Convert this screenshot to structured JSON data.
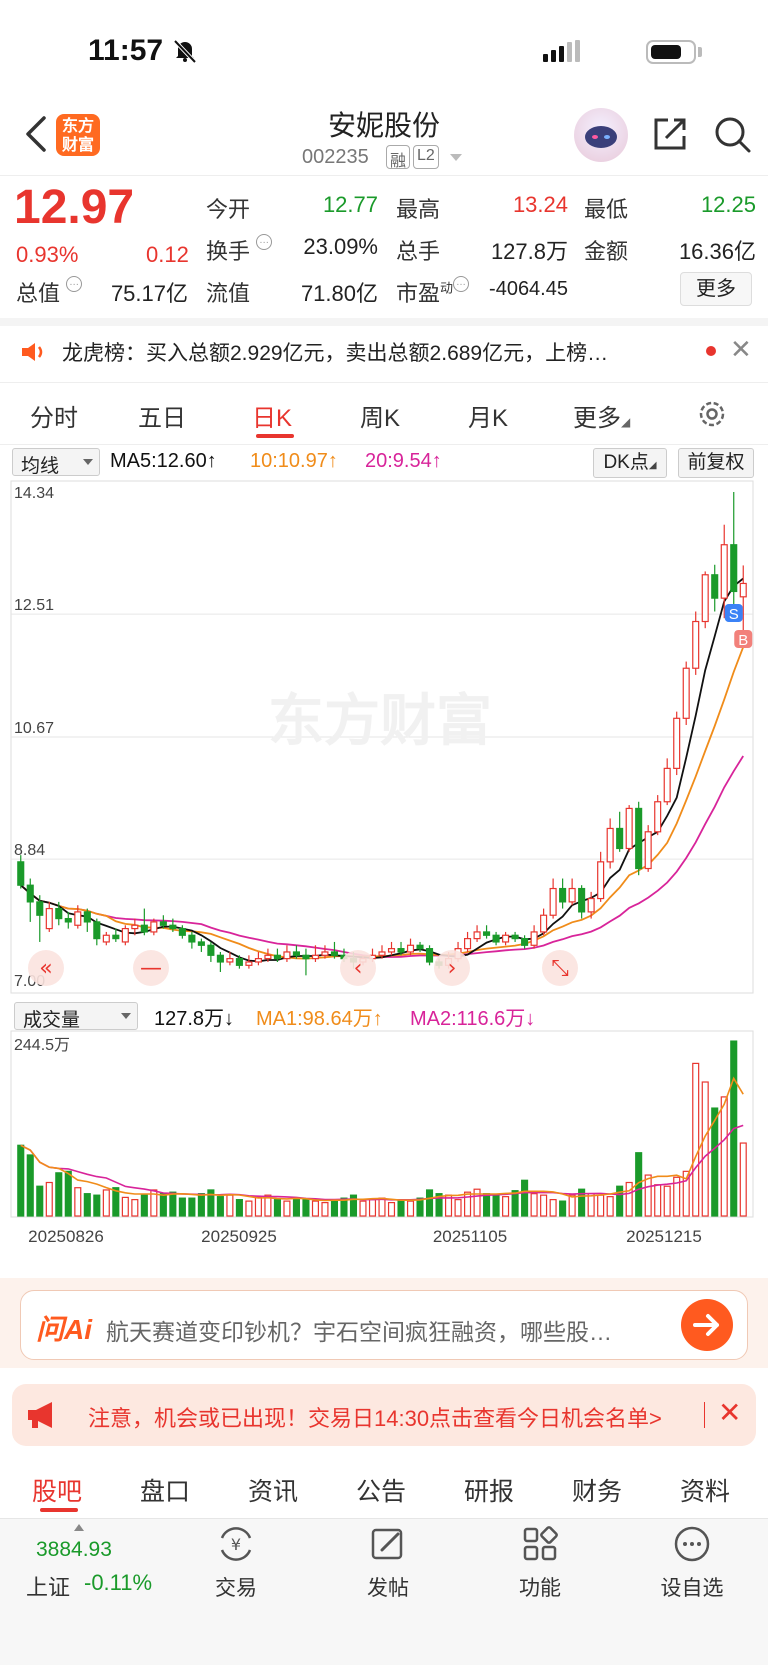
{
  "status": {
    "time": "11:57"
  },
  "header": {
    "name": "安妮股份",
    "code": "002235",
    "badge1": "融",
    "badge2": "L2",
    "logo_line1": "东方",
    "logo_line2": "财富"
  },
  "quote": {
    "price": "12.97",
    "pct": "0.93%",
    "change": "0.12",
    "open_label": "今开",
    "open": "12.77",
    "high_label": "最高",
    "high": "13.24",
    "low_label": "最低",
    "low": "12.25",
    "turnover_label": "换手",
    "turnover": "23.09%",
    "volume_label": "总手",
    "volume": "127.8万",
    "amount_label": "金额",
    "amount": "16.36亿",
    "mcap_label": "总值",
    "mcap": "75.17亿",
    "float_label": "流值",
    "float": "71.80亿",
    "pe_label": "市盈",
    "pe_sup": "动",
    "pe": "-4064.45",
    "more": "更多"
  },
  "notice": {
    "text": "龙虎榜：买入总额2.929亿元，卖出总额2.689亿元，上榜…"
  },
  "tabs": [
    "分时",
    "五日",
    "日K",
    "周K",
    "月K",
    "更多"
  ],
  "active_tab": 2,
  "chart_toolbar": {
    "indicator": "均线",
    "ma5": "MA5:12.60↑",
    "ma10": "10:10.97↑",
    "ma20": "20:9.54↑",
    "dk": "DK点",
    "adjust": "前复权",
    "ma5_color": "#111111",
    "ma10_color": "#f08c1a",
    "ma20_color": "#d8249a"
  },
  "volume_toolbar": {
    "indicator": "成交量",
    "vol": "127.8万↓",
    "ma1": "MA1:98.64万↑",
    "ma2": "MA2:116.6万↓"
  },
  "chart_data": {
    "type": "candlestick",
    "y_ticks": [
      "14.34",
      "12.51",
      "10.67",
      "8.84",
      "7.00"
    ],
    "ylim": [
      7.0,
      14.34
    ],
    "vol_max_label": "244.5万",
    "x_ticks": [
      "20250826",
      "20250925",
      "20251105",
      "20251215"
    ],
    "watermark": "东方财富",
    "up_color": "#e8352e",
    "down_color": "#1a9a2a",
    "candles": [
      [
        8.8,
        8.45,
        8.9,
        8.4
      ],
      [
        8.45,
        8.2,
        8.55,
        7.9
      ],
      [
        8.2,
        8.0,
        8.3,
        7.6
      ],
      [
        7.8,
        8.1,
        8.2,
        7.75
      ],
      [
        8.1,
        7.95,
        8.2,
        7.85
      ],
      [
        7.95,
        7.9,
        8.05,
        7.8
      ],
      [
        7.85,
        8.05,
        8.15,
        7.8
      ],
      [
        8.05,
        7.9,
        8.1,
        7.75
      ],
      [
        7.9,
        7.65,
        7.95,
        7.55
      ],
      [
        7.6,
        7.7,
        7.75,
        7.55
      ],
      [
        7.7,
        7.65,
        7.8,
        7.6
      ],
      [
        7.6,
        7.8,
        7.85,
        7.55
      ],
      [
        7.8,
        7.85,
        7.95,
        7.7
      ],
      [
        7.85,
        7.75,
        8.1,
        7.7
      ],
      [
        7.75,
        7.9,
        7.95,
        7.7
      ],
      [
        7.9,
        7.85,
        8.0,
        7.8
      ],
      [
        7.85,
        7.8,
        7.95,
        7.75
      ],
      [
        7.8,
        7.7,
        7.85,
        7.65
      ],
      [
        7.7,
        7.6,
        7.75,
        7.5
      ],
      [
        7.6,
        7.55,
        7.65,
        7.45
      ],
      [
        7.55,
        7.4,
        7.6,
        7.3
      ],
      [
        7.4,
        7.3,
        7.45,
        7.15
      ],
      [
        7.3,
        7.35,
        7.45,
        7.25
      ],
      [
        7.35,
        7.25,
        7.4,
        7.2
      ],
      [
        7.25,
        7.3,
        7.4,
        7.2
      ],
      [
        7.3,
        7.35,
        7.45,
        7.25
      ],
      [
        7.35,
        7.4,
        7.5,
        7.3
      ],
      [
        7.4,
        7.35,
        7.5,
        7.3
      ],
      [
        7.35,
        7.45,
        7.55,
        7.3
      ],
      [
        7.45,
        7.4,
        7.55,
        7.35
      ],
      [
        7.4,
        7.35,
        7.5,
        7.1
      ],
      [
        7.35,
        7.4,
        7.55,
        7.3
      ],
      [
        7.4,
        7.45,
        7.55,
        7.35
      ],
      [
        7.45,
        7.4,
        7.6,
        7.35
      ],
      [
        7.4,
        7.35,
        7.5,
        7.3
      ],
      [
        7.35,
        7.3,
        7.45,
        7.2
      ],
      [
        7.3,
        7.35,
        7.4,
        7.25
      ],
      [
        7.35,
        7.4,
        7.5,
        7.3
      ],
      [
        7.4,
        7.45,
        7.55,
        7.35
      ],
      [
        7.45,
        7.5,
        7.6,
        7.4
      ],
      [
        7.5,
        7.45,
        7.6,
        7.4
      ],
      [
        7.45,
        7.55,
        7.65,
        7.4
      ],
      [
        7.55,
        7.5,
        7.6,
        7.45
      ],
      [
        7.5,
        7.3,
        7.55,
        7.25
      ],
      [
        7.3,
        7.25,
        7.35,
        7.2
      ],
      [
        7.25,
        7.35,
        7.45,
        7.2
      ],
      [
        7.35,
        7.5,
        7.6,
        7.3
      ],
      [
        7.5,
        7.65,
        7.75,
        7.45
      ],
      [
        7.65,
        7.75,
        7.85,
        7.6
      ],
      [
        7.75,
        7.7,
        7.85,
        7.65
      ],
      [
        7.7,
        7.6,
        7.75,
        7.55
      ],
      [
        7.6,
        7.7,
        7.75,
        7.55
      ],
      [
        7.7,
        7.65,
        7.75,
        7.6
      ],
      [
        7.65,
        7.55,
        7.7,
        7.5
      ],
      [
        7.55,
        7.75,
        7.85,
        7.5
      ],
      [
        7.75,
        8.0,
        8.1,
        7.7
      ],
      [
        8.0,
        8.4,
        8.55,
        7.95
      ],
      [
        8.4,
        8.2,
        8.55,
        8.1
      ],
      [
        8.2,
        8.4,
        8.55,
        8.15
      ],
      [
        8.4,
        8.05,
        8.45,
        7.95
      ],
      [
        8.05,
        8.25,
        8.35,
        7.95
      ],
      [
        8.25,
        8.8,
        8.95,
        8.2
      ],
      [
        8.8,
        9.3,
        9.45,
        8.7
      ],
      [
        9.3,
        9.0,
        9.55,
        8.95
      ],
      [
        9.0,
        9.6,
        9.65,
        8.95
      ],
      [
        9.6,
        8.7,
        9.7,
        8.6
      ],
      [
        8.7,
        9.25,
        9.35,
        8.65
      ],
      [
        9.25,
        9.7,
        9.8,
        9.2
      ],
      [
        9.7,
        10.2,
        10.35,
        9.65
      ],
      [
        10.2,
        10.95,
        11.05,
        10.1
      ],
      [
        10.95,
        11.7,
        11.8,
        10.85
      ],
      [
        11.7,
        12.4,
        12.55,
        11.6
      ],
      [
        12.4,
        13.1,
        13.15,
        12.3
      ],
      [
        13.1,
        12.75,
        13.25,
        12.55
      ],
      [
        12.75,
        13.55,
        13.85,
        12.45
      ],
      [
        13.55,
        12.85,
        14.34,
        12.6
      ],
      [
        12.77,
        12.97,
        13.24,
        12.25
      ]
    ],
    "volumes": [
      95,
      82,
      40,
      45,
      58,
      60,
      38,
      30,
      28,
      35,
      38,
      25,
      22,
      28,
      35,
      30,
      32,
      24,
      24,
      30,
      35,
      26,
      28,
      22,
      20,
      25,
      28,
      22,
      20,
      24,
      22,
      20,
      18,
      22,
      24,
      28,
      20,
      22,
      24,
      18,
      22,
      20,
      24,
      35,
      30,
      28,
      22,
      32,
      36,
      30,
      28,
      26,
      34,
      48,
      30,
      28,
      22,
      20,
      28,
      36,
      30,
      28,
      26,
      40,
      45,
      85,
      55,
      42,
      40,
      52,
      60,
      205,
      180,
      145,
      160,
      235,
      98
    ]
  },
  "ask_ai": {
    "logo": "问Ai",
    "text": "航天赛道变印钞机？宇石空间疯狂融资，哪些股…"
  },
  "alert": {
    "text": "注意，机会或已出现！交易日14:30点击查看今日机会名单>"
  },
  "bottom_tabs": [
    "股吧",
    "盘口",
    "资讯",
    "公告",
    "研报",
    "财务",
    "资料"
  ],
  "active_bottom_tab": 0,
  "nav": {
    "index_value": "3884.93",
    "index_name": "上证",
    "index_change": "-0.11%",
    "trade": "交易",
    "post": "发帖",
    "func": "功能",
    "watch": "设自选"
  }
}
